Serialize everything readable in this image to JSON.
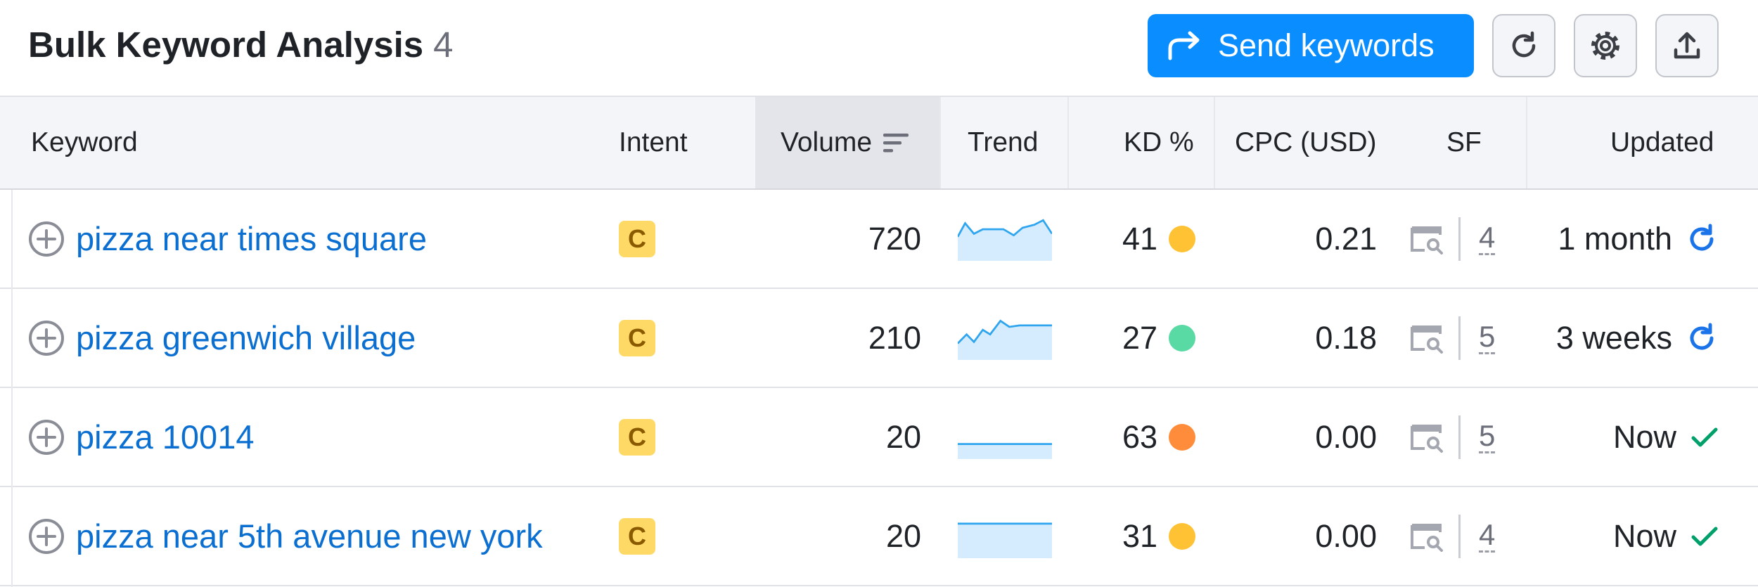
{
  "header": {
    "title": "Bulk Keyword Analysis",
    "count": "4",
    "send_label": "Send keywords"
  },
  "colors": {
    "accent": "#0a8dff",
    "link": "#0a6fd1",
    "intent_bg": "#ffd966",
    "kd_yellow": "#ffc234",
    "kd_green": "#59d9a4",
    "kd_orange": "#ff8c3a",
    "refresh_blue": "#1a73e8",
    "check_green": "#009f6b"
  },
  "columns": {
    "keyword": "Keyword",
    "intent": "Intent",
    "volume": "Volume",
    "trend": "Trend",
    "kd": "KD %",
    "cpc": "CPC (USD)",
    "sf": "SF",
    "updated": "Updated"
  },
  "rows": [
    {
      "keyword": "pizza near times square",
      "intent": "C",
      "volume": "720",
      "trend": "trend-varied",
      "kd": "41",
      "kd_level": "medium",
      "cpc": "0.21",
      "sf": "4",
      "updated": "1 month",
      "updated_icon": "refresh-icon"
    },
    {
      "keyword": "pizza greenwich village",
      "intent": "C",
      "volume": "210",
      "trend": "trend-varied",
      "kd": "27",
      "kd_level": "low",
      "cpc": "0.18",
      "sf": "5",
      "updated": "3 weeks",
      "updated_icon": "refresh-icon"
    },
    {
      "keyword": "pizza 10014",
      "intent": "C",
      "volume": "20",
      "trend": "trend-flat",
      "kd": "63",
      "kd_level": "high",
      "cpc": "0.00",
      "sf": "5",
      "updated": "Now",
      "updated_icon": "check-icon"
    },
    {
      "keyword": "pizza near 5th avenue new york",
      "intent": "C",
      "volume": "20",
      "trend": "trend-flat",
      "kd": "31",
      "kd_level": "medium",
      "cpc": "0.00",
      "sf": "4",
      "updated": "Now",
      "updated_icon": "check-icon"
    }
  ]
}
